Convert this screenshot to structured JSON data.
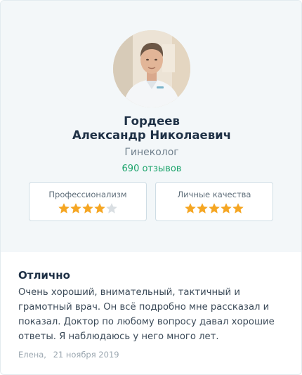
{
  "doctor": {
    "last_name": "Гордеев",
    "first_middle_name": "Александр Николаевич",
    "specialty": "Гинеколог",
    "reviews_count": "690 отзывов"
  },
  "ratings": [
    {
      "label": "Профессионализм",
      "stars": 4,
      "max": 5
    },
    {
      "label": "Личные качества",
      "stars": 5,
      "max": 5
    }
  ],
  "review": {
    "title": "Отлично",
    "text": "Очень хороший, внимательный, тактичный и грамотный врач. Он всё подробно мне рассказал и показал. Доктор по любому вопросу давал хорошие ответы. Я наблюдаюсь у него много лет.",
    "author": "Елена,",
    "date": "21 ноября 2019"
  },
  "colors": {
    "star_filled": "#f5a623",
    "star_empty": "#d9dee2",
    "accent_green": "#1aa36a",
    "profile_bg": "#f3f7f9"
  }
}
